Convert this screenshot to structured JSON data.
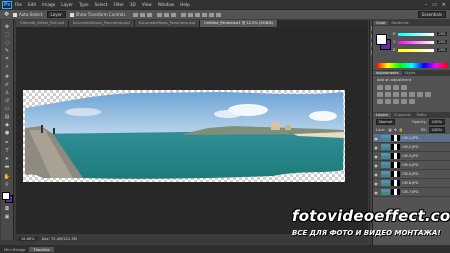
{
  "app": {
    "logo": "Ps",
    "window_controls": [
      "–",
      "▭",
      "✕"
    ]
  },
  "menu": [
    "File",
    "Edit",
    "Image",
    "Layer",
    "Type",
    "Select",
    "Filter",
    "3D",
    "View",
    "Window",
    "Help"
  ],
  "options": {
    "auto_select_label": "Auto-Select:",
    "auto_select_value": "Layer",
    "show_transform_label": "Show Transform Controls",
    "workspace": "Essentials"
  },
  "tabs": [
    {
      "label": "Ultimate_Nikkel_Pod.psd",
      "active": false
    },
    {
      "label": "KuLomebetSaan_Panorama.psd",
      "active": false
    },
    {
      "label": "KuLomebetNaas_Panorama.psd",
      "active": false
    },
    {
      "label": "Untitled_Panorama1 @ 12.5% (RGB/8)",
      "active": true
    }
  ],
  "statusbar": {
    "zoom": "16.66%",
    "doc_info": "Doc: 72.4M/121.3M"
  },
  "bottom_tabs": [
    {
      "label": "Mini Bridge",
      "active": false
    },
    {
      "label": "Timeline",
      "active": true
    }
  ],
  "color_panel": {
    "tabs": [
      "Color",
      "Swatches"
    ],
    "fg_color": "#ffffff",
    "bg_color": "#6a28a8",
    "sliders": [
      {
        "label": "R",
        "value": "255"
      },
      {
        "label": "G",
        "value": "255"
      },
      {
        "label": "B",
        "value": "255"
      }
    ]
  },
  "adjustments_panel": {
    "tabs": [
      "Adjustments",
      "Styles"
    ],
    "title": "Add an adjustment"
  },
  "layers_panel": {
    "tabs": [
      "Layers",
      "Channels",
      "Paths"
    ],
    "blend_mode": "Normal",
    "opacity_label": "Opacity:",
    "opacity_value": "100%",
    "lock_label": "Lock:",
    "fill_label": "Fill:",
    "fill_value": "100%",
    "layers": [
      {
        "name": "CM-1.JPG",
        "selected": true
      },
      {
        "name": "CM-2.JPG",
        "selected": false
      },
      {
        "name": "CM-3.JPG",
        "selected": false
      },
      {
        "name": "CM-4.JPG",
        "selected": false
      },
      {
        "name": "CM-5.JPG",
        "selected": false
      },
      {
        "name": "CM-6.JPG",
        "selected": false
      },
      {
        "name": "CM-7.JPG",
        "selected": false
      }
    ]
  },
  "watermark": {
    "title": "fotovideoeffect.com",
    "subtitle": "ВСЕ ДЛЯ ФОТО И ВИДЕО МОНТАЖА!"
  }
}
